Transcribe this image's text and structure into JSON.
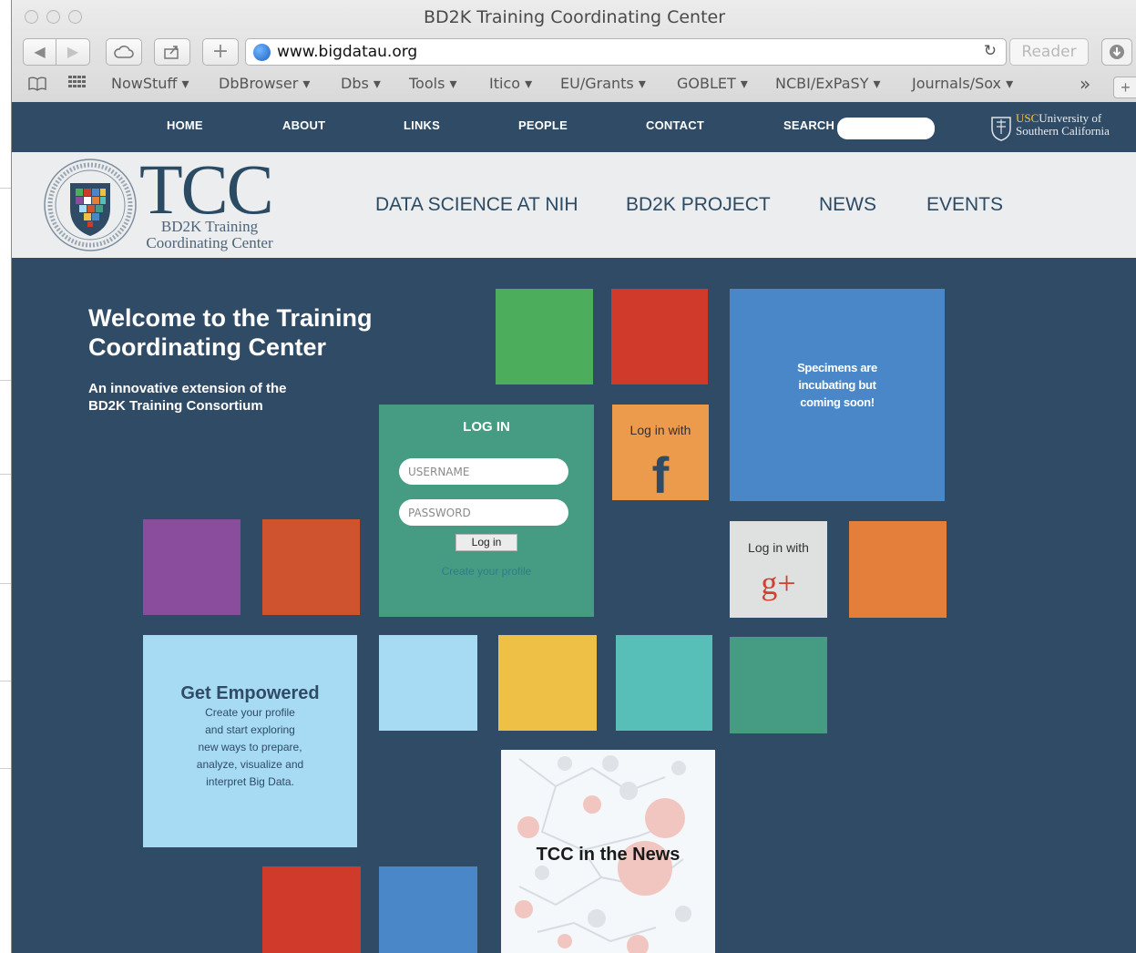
{
  "browser": {
    "title": "BD2K Training Coordinating Center",
    "url": "www.bigdatau.org",
    "reader_label": "Reader",
    "bookmarks": [
      "NowStuff ▾",
      "DbBrowser ▾",
      "Dbs ▾",
      "Tools ▾",
      "Itico ▾",
      "EU/Grants ▾",
      "GOBLET ▾",
      "NCBI/ExPaSY ▾",
      "Journals/Sox ▾"
    ],
    "more_label": "»"
  },
  "topnav": {
    "items": [
      "HOME",
      "ABOUT",
      "LINKS",
      "PEOPLE",
      "CONTACT"
    ],
    "search_label": "SEARCH",
    "usc_prefix": "USC",
    "usc_text_1": "University of",
    "usc_text_2": "Southern California"
  },
  "logo": {
    "letters": "TCC",
    "line1": "BD2K Training",
    "line2": "Coordinating Center"
  },
  "mainnav": {
    "items": [
      "DATA SCIENCE AT NIH",
      "BD2K PROJECT",
      "NEWS",
      "EVENTS"
    ]
  },
  "welcome": {
    "title_line1": "Welcome to the Training",
    "title_line2": "Coordinating Center",
    "subtitle_line1": "An innovative extension of the",
    "subtitle_line2": "BD2K Training Consortium"
  },
  "login": {
    "heading": "LOG IN",
    "username_placeholder": "USERNAME",
    "password_placeholder": "PASSWORD",
    "button": "Log in",
    "create_profile": "Create your profile"
  },
  "facebook_tile": {
    "label": "Log in with",
    "glyph": "f"
  },
  "google_tile": {
    "label": "Log in with",
    "glyph": "g+"
  },
  "specimens": {
    "line1": "Specimens are",
    "line2": "incubating but",
    "line3": "coming soon!"
  },
  "empowered": {
    "title": "Get Empowered",
    "lines": [
      "Create your profile",
      "and start exploring",
      "new ways to prepare,",
      "analyze, visualize and",
      "interpret Big Data."
    ]
  },
  "news_tile": {
    "title": "TCC in the News"
  },
  "colors": {
    "page_bg": "#2f4b66",
    "green": "#4cae5c",
    "red": "#cf3a2b",
    "blue": "#4a87c9",
    "teal_green": "#469c82",
    "orange": "#ec9a4c",
    "purple": "#8a4d9e",
    "orange_red": "#d0532f",
    "light_blue": "#a7dbf3",
    "yellow": "#eec046",
    "turquoise": "#58beb8",
    "orange2": "#e37f3a",
    "google_tile": "#dfe0e0"
  }
}
